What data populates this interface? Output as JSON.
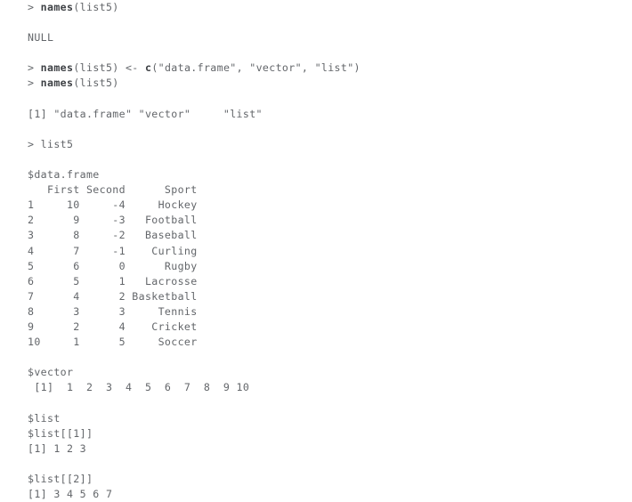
{
  "console": {
    "prompt": ">",
    "lines": [
      {
        "type": "input",
        "segments": [
          {
            "text": "> ",
            "bold": false
          },
          {
            "text": "names",
            "bold": true
          },
          {
            "text": "(list5)",
            "bold": false
          }
        ]
      },
      {
        "type": "blank",
        "text": ""
      },
      {
        "type": "output",
        "text": "NULL"
      },
      {
        "type": "blank",
        "text": ""
      },
      {
        "type": "input",
        "segments": [
          {
            "text": "> ",
            "bold": false
          },
          {
            "text": "names",
            "bold": true
          },
          {
            "text": "(list5) <- ",
            "bold": false
          },
          {
            "text": "c",
            "bold": true
          },
          {
            "text": "(\"data.frame\", \"vector\", \"list\")",
            "bold": false
          }
        ]
      },
      {
        "type": "input",
        "segments": [
          {
            "text": "> ",
            "bold": false
          },
          {
            "text": "names",
            "bold": true
          },
          {
            "text": "(list5)",
            "bold": false
          }
        ]
      },
      {
        "type": "blank",
        "text": ""
      },
      {
        "type": "output",
        "text": "[1] \"data.frame\" \"vector\"     \"list\""
      },
      {
        "type": "blank",
        "text": ""
      },
      {
        "type": "input",
        "segments": [
          {
            "text": "> list5",
            "bold": false
          }
        ]
      },
      {
        "type": "blank",
        "text": ""
      },
      {
        "type": "output",
        "text": "$data.frame"
      },
      {
        "type": "output",
        "text": "   First Second      Sport"
      },
      {
        "type": "output",
        "text": "1     10     -4     Hockey"
      },
      {
        "type": "output",
        "text": "2      9     -3   Football"
      },
      {
        "type": "output",
        "text": "3      8     -2   Baseball"
      },
      {
        "type": "output",
        "text": "4      7     -1    Curling"
      },
      {
        "type": "output",
        "text": "5      6      0      Rugby"
      },
      {
        "type": "output",
        "text": "6      5      1   Lacrosse"
      },
      {
        "type": "output",
        "text": "7      4      2 Basketball"
      },
      {
        "type": "output",
        "text": "8      3      3     Tennis"
      },
      {
        "type": "output",
        "text": "9      2      4    Cricket"
      },
      {
        "type": "output",
        "text": "10     1      5     Soccer"
      },
      {
        "type": "blank",
        "text": ""
      },
      {
        "type": "output",
        "text": "$vector"
      },
      {
        "type": "output",
        "text": " [1]  1  2  3  4  5  6  7  8  9 10"
      },
      {
        "type": "blank",
        "text": ""
      },
      {
        "type": "output",
        "text": "$list"
      },
      {
        "type": "output",
        "text": "$list[[1]]"
      },
      {
        "type": "output",
        "text": "[1] 1 2 3"
      },
      {
        "type": "blank",
        "text": ""
      },
      {
        "type": "output",
        "text": "$list[[2]]"
      },
      {
        "type": "output",
        "text": "[1] 3 4 5 6 7"
      }
    ],
    "data_frame": {
      "name": "$data.frame",
      "columns": [
        "",
        "First",
        "Second",
        "Sport"
      ],
      "rows": [
        [
          "1",
          "10",
          "-4",
          "Hockey"
        ],
        [
          "2",
          "9",
          "-3",
          "Football"
        ],
        [
          "3",
          "8",
          "-2",
          "Baseball"
        ],
        [
          "4",
          "7",
          "-1",
          "Curling"
        ],
        [
          "5",
          "6",
          "0",
          "Rugby"
        ],
        [
          "6",
          "5",
          "1",
          "Lacrosse"
        ],
        [
          "7",
          "4",
          "2",
          "Basketball"
        ],
        [
          "8",
          "3",
          "3",
          "Tennis"
        ],
        [
          "9",
          "2",
          "4",
          "Cricket"
        ],
        [
          "10",
          "1",
          "5",
          "Soccer"
        ]
      ]
    },
    "vector": {
      "name": "$vector",
      "index_label": "[1]",
      "values": [
        1,
        2,
        3,
        4,
        5,
        6,
        7,
        8,
        9,
        10
      ]
    },
    "list": {
      "name": "$list",
      "elements": [
        {
          "name": "$list[[1]]",
          "index_label": "[1]",
          "values": [
            1,
            2,
            3
          ]
        },
        {
          "name": "$list[[2]]",
          "index_label": "[1]",
          "values": [
            3,
            4,
            5,
            6,
            7
          ]
        }
      ]
    },
    "names_result": [
      "data.frame",
      "vector",
      "list"
    ],
    "colors": {
      "background": "#ffffff",
      "text": "#63666a",
      "keyword": "#3e4145"
    }
  }
}
